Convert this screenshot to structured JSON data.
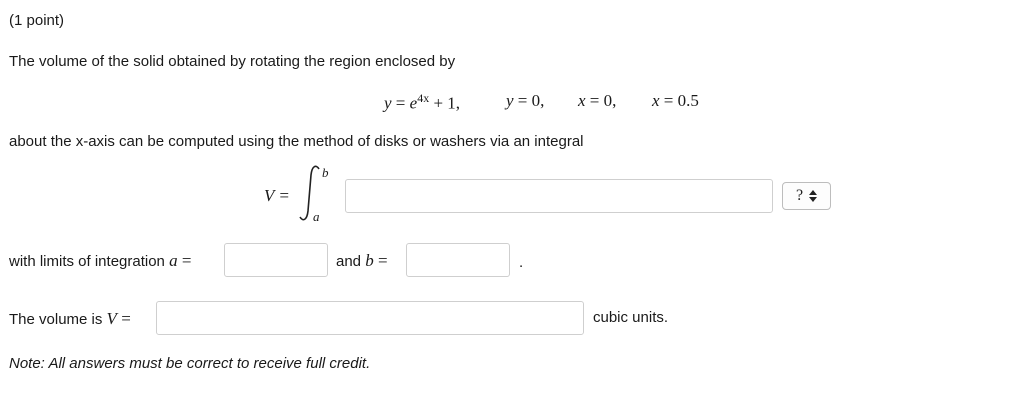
{
  "points": "(1 point)",
  "intro": "The volume of the solid obtained by rotating the region enclosed by",
  "equations": {
    "eq1": {
      "lhs": "y",
      "eq": " = ",
      "base": "e",
      "exp": "4x",
      "rest": " + 1,"
    },
    "eq2": {
      "lhs": "y",
      "rest": " = 0,"
    },
    "eq3": {
      "lhs": "x",
      "rest": " = 0,"
    },
    "eq4": {
      "lhs": "x",
      "rest": " = 0.5"
    }
  },
  "method_text": "about the x-axis can be computed using the method of disks or washers via an integral",
  "integral": {
    "lhs": "V =",
    "upper": "b",
    "lower": "a"
  },
  "integrand_input": {
    "value": ""
  },
  "help_button": {
    "label": "?"
  },
  "limits": {
    "label": "with limits of integration",
    "a_var": "a",
    "equals": " =",
    "a_value": "",
    "and_label": "and",
    "b_var": "b",
    "b_value": "",
    "period": "."
  },
  "volume": {
    "label": "The volume is",
    "var": "V",
    "equals": " =",
    "value": "",
    "units": "cubic units."
  },
  "note": "Note: All answers must be correct to receive full credit."
}
